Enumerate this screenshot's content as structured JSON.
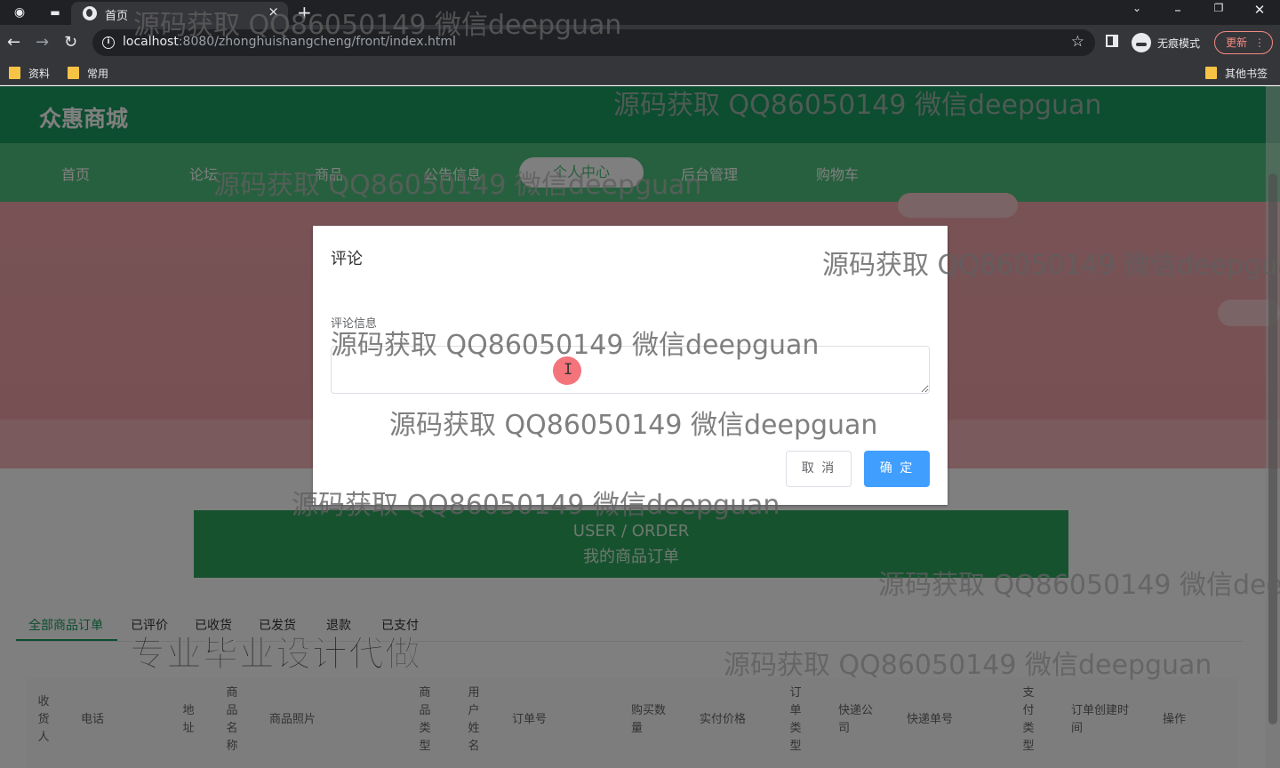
{
  "browser": {
    "tab_title": "首页",
    "new_tab_symbol": "+",
    "close_symbol": "×",
    "url_host": "localhost",
    "url_rest": ":8080/zhonghuishangcheng/front/index.html",
    "incognito_label": "无痕模式",
    "update_label": "更新",
    "bookmarks": [
      "资料",
      "常用"
    ],
    "other_bookmarks": "其他书签"
  },
  "site": {
    "brand": "众惠商城",
    "nav": [
      "首页",
      "论坛",
      "商品",
      "公告信息",
      "个人中心",
      "后台管理",
      "购物车"
    ],
    "active_nav": "个人中心"
  },
  "order_section": {
    "banner_en": "USER / ORDER",
    "banner_cn": "我的商品订单",
    "tabs": [
      "全部商品订单",
      "已评价",
      "已收货",
      "已发货",
      "退款",
      "已支付"
    ],
    "active_tab": "全部商品订单",
    "promo": "专业毕业设计代做",
    "columns": [
      "收货人",
      "电话",
      "地址",
      "商品名称",
      "商品照片",
      "商品类型",
      "用户姓名",
      "订单号",
      "购买数量",
      "实付价格",
      "订单类型",
      "快递公司",
      "快递单号",
      "支付类型",
      "订单创建时间",
      "操作"
    ]
  },
  "dialog": {
    "title": "评论",
    "field_label": "评论信息",
    "textarea_value": "",
    "cancel_label": "取 消",
    "confirm_label": "确 定"
  },
  "watermark": "源码获取 QQ86050149 微信deepguan",
  "colors": {
    "brand_green": "#1a9a60",
    "nav_green": "#4ec07d",
    "primary_blue": "#409eff"
  }
}
